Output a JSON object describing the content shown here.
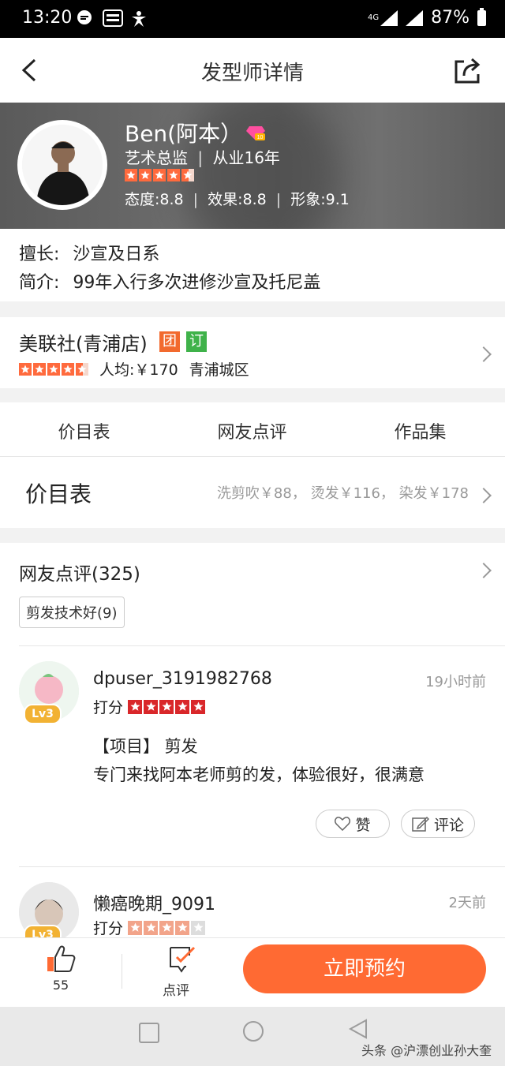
{
  "status_bar": {
    "time": "13:20",
    "network": "4G",
    "battery": "87%"
  },
  "header": {
    "title": "发型师详情"
  },
  "stylist": {
    "name": "Ben(阿本）",
    "level_badge": "10",
    "role": "艺术总监",
    "experience": "从业16年",
    "rating_stars": 4.5,
    "scores": "态度:8.8 | 效果:8.8 | 形象:9.1",
    "score_attitude": "态度:8.8",
    "score_effect": "效果:8.8",
    "score_image": "形象:9.1",
    "specialty_label": "擅长:",
    "specialty": "沙宣及日系",
    "intro_label": "简介:",
    "intro": "99年入行多次进修沙宣及托尼盖"
  },
  "shop": {
    "name": "美联社(青浦店)",
    "tag_tuan": "团",
    "tag_ding": "订",
    "tag_tuan_color": "#f26a2e",
    "tag_ding_color": "#3fb24a",
    "rating_stars": 4.5,
    "avg_price": "人均:￥170",
    "district": "青浦城区"
  },
  "tabs": [
    "价目表",
    "网友点评",
    "作品集"
  ],
  "price_list": {
    "title": "价目表",
    "summary": "洗剪吹￥88， 烫发￥116， 染发￥178"
  },
  "reviews": {
    "title": "网友点评(325)",
    "chip": "剪发技术好(9)",
    "items": [
      {
        "user": "dpuser_3191982768",
        "level": "Lv3",
        "time": "19小时前",
        "score_label": "打分",
        "stars": 5,
        "project": "【项目】 剪发",
        "text": "专门来找阿本老师剪的发，体验很好，很满意",
        "like_label": "赞",
        "comment_label": "评论"
      },
      {
        "user": "懒癌晚期_9091",
        "level": "Lv3",
        "time": "2天前",
        "score_label": "打分",
        "stars": 4
      }
    ]
  },
  "bottom_bar": {
    "like_count": "55",
    "review_label": "点评",
    "book_label": "立即预约",
    "accent": "#ff6a33"
  },
  "watermark": "头条 @沪漂创业孙大奎"
}
